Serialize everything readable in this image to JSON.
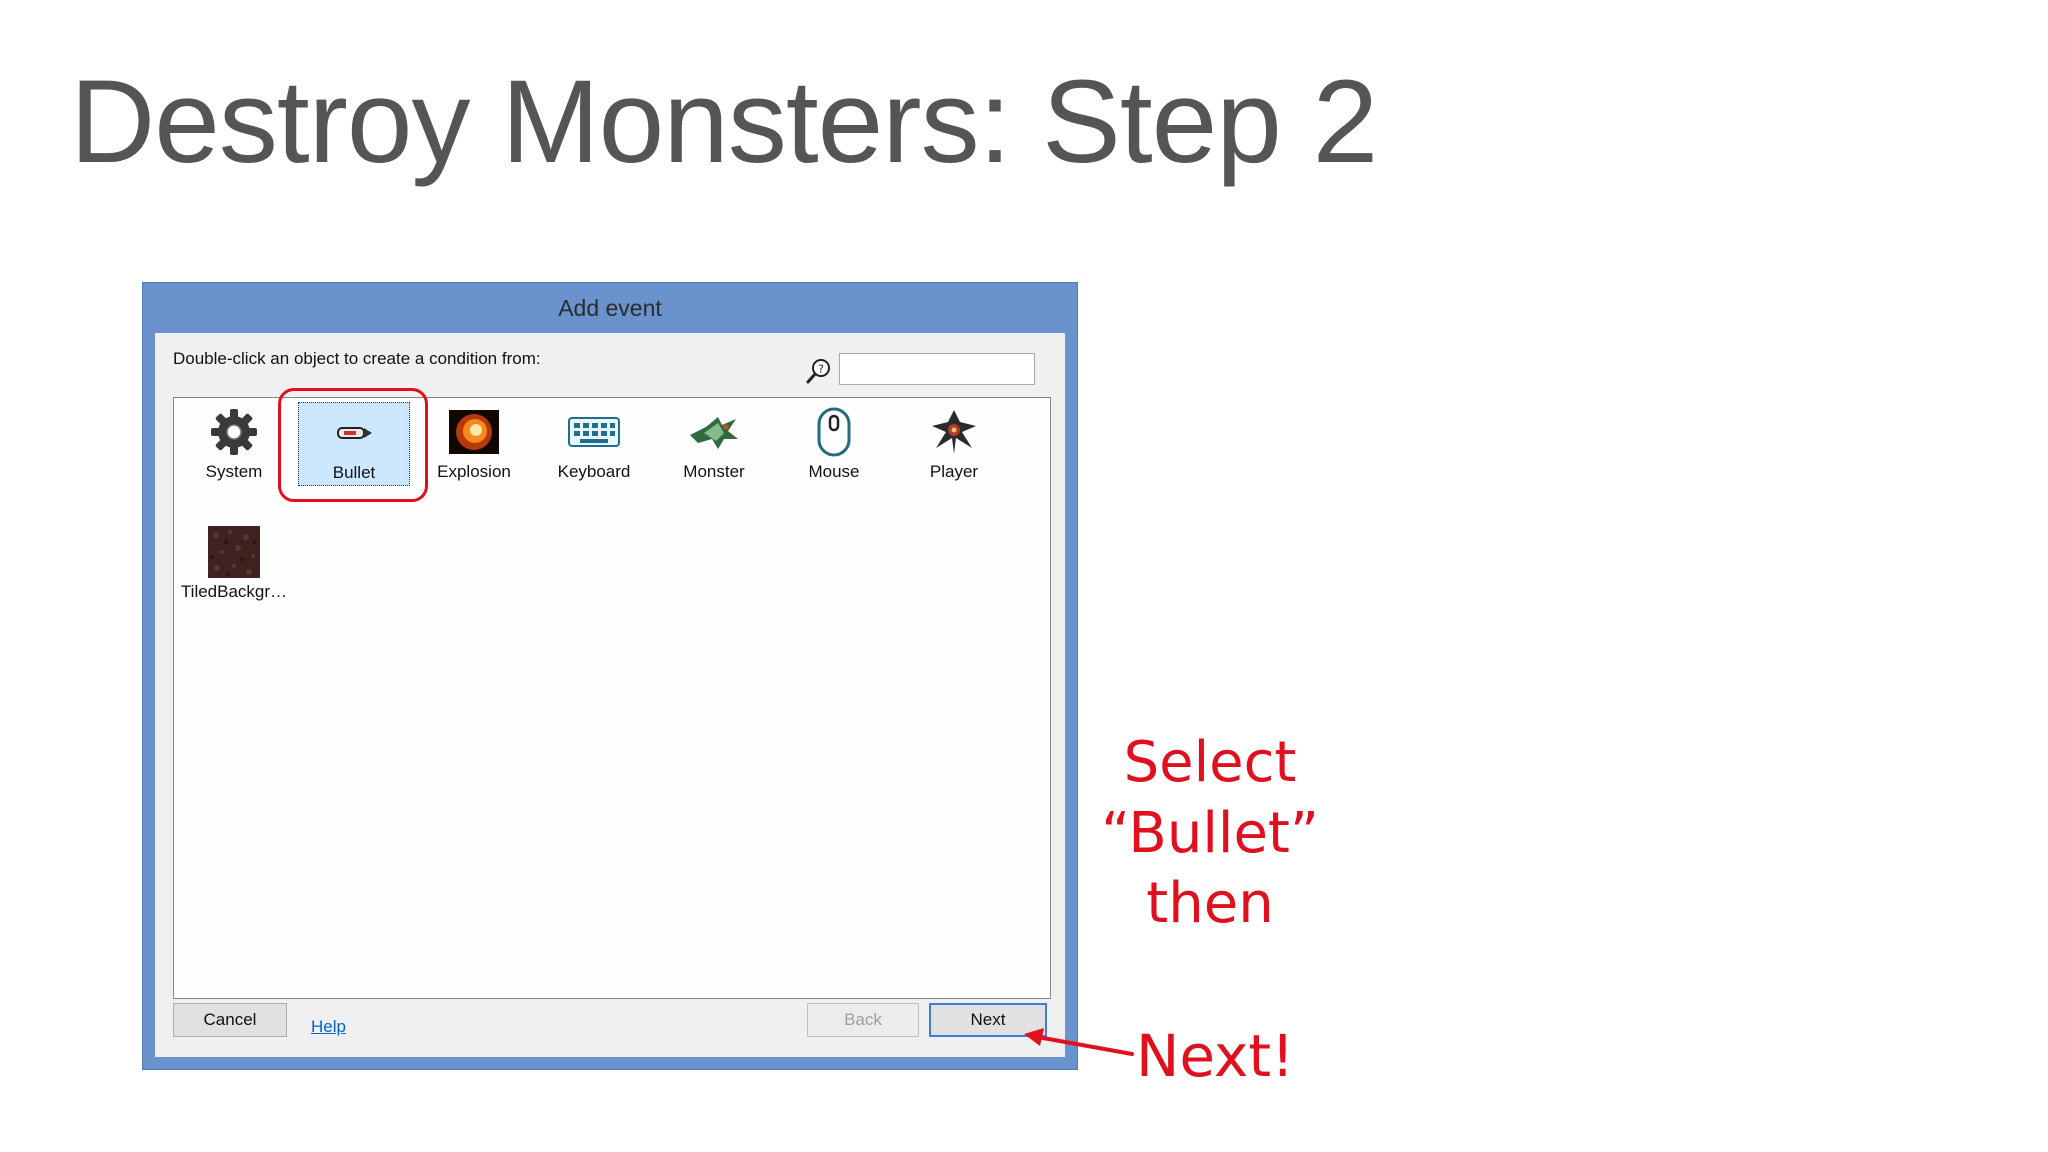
{
  "slide": {
    "title": "Destroy Monsters: Step 2"
  },
  "dialog": {
    "title": "Add event",
    "instruction": "Double-click an object to create a condition from:",
    "search": {
      "value": "",
      "placeholder": ""
    },
    "objects": [
      {
        "label": "System",
        "icon": "gear-icon"
      },
      {
        "label": "Bullet",
        "icon": "bullet-icon",
        "selected": true
      },
      {
        "label": "Explosion",
        "icon": "explosion-icon"
      },
      {
        "label": "Keyboard",
        "icon": "keyboard-icon"
      },
      {
        "label": "Monster",
        "icon": "monster-icon"
      },
      {
        "label": "Mouse",
        "icon": "mouse-icon"
      },
      {
        "label": "Player",
        "icon": "player-icon"
      },
      {
        "label": "TiledBackgr…",
        "icon": "tiled-background-icon"
      }
    ],
    "buttons": {
      "cancel": "Cancel",
      "help": "Help",
      "back": "Back",
      "next": "Next"
    }
  },
  "annotations": {
    "select_line1": "Select",
    "select_line2": "“Bullet”",
    "select_line3": "then",
    "next": "Next!"
  },
  "colors": {
    "window_chrome": "#6a93ce",
    "selection": "#cce8ff",
    "annotation": "#e0101f",
    "title_text": "#555555"
  }
}
